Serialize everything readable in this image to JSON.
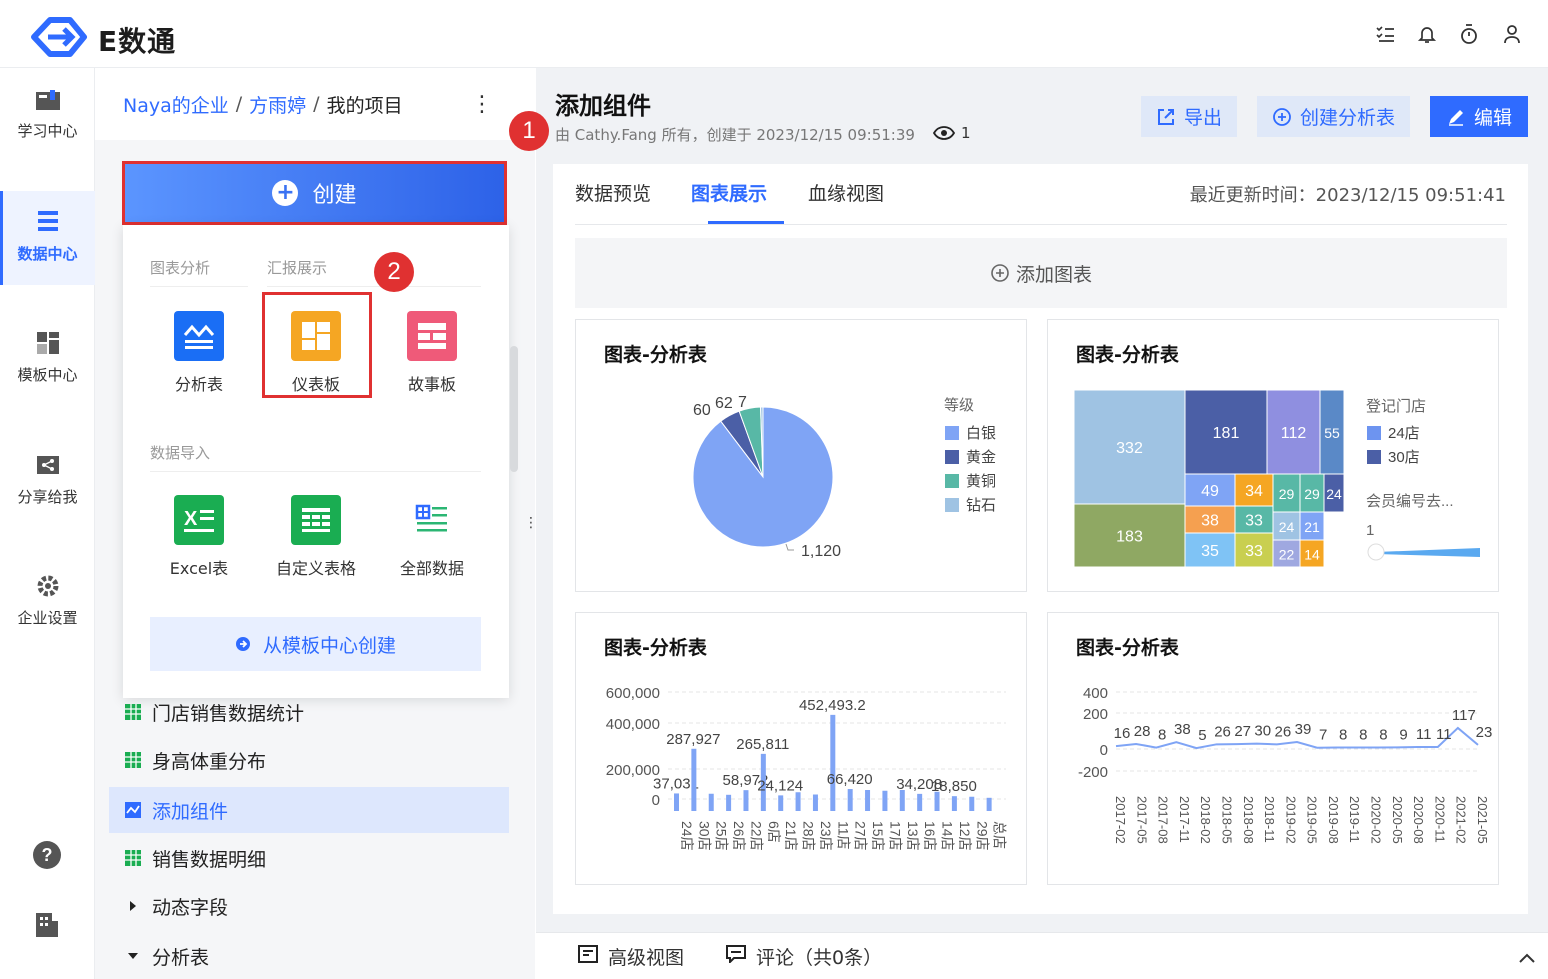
{
  "app": {
    "brand": "E数通",
    "brand_color": "#2f6bff"
  },
  "topbar": {
    "icons": [
      "checklist-icon",
      "bell-icon",
      "timer-icon",
      "user-icon"
    ]
  },
  "sidenav": {
    "items": [
      {
        "label": "学习中心",
        "icon": "book-icon"
      },
      {
        "label": "数据中心",
        "icon": "database-icon",
        "active": true
      },
      {
        "label": "模板中心",
        "icon": "template-icon"
      },
      {
        "label": "分享给我",
        "icon": "share-icon"
      },
      {
        "label": "企业设置",
        "icon": "settings-icon"
      }
    ],
    "bottom_icons": [
      "help-icon",
      "building-icon"
    ]
  },
  "breadcrumb": {
    "items": [
      "Naya的企业",
      "方雨婷",
      "我的项目"
    ],
    "separator": "/",
    "more": "⋮"
  },
  "create_button": {
    "label": "创建",
    "plus": "+"
  },
  "dropdown": {
    "section1": "图表分析",
    "section2": "汇报展示",
    "analysis_items": [
      {
        "label": "分析表",
        "color": "#1a6ef5"
      },
      {
        "label": "仪表板",
        "color": "#f5a623"
      },
      {
        "label": "故事板",
        "color": "#ef5a79"
      }
    ],
    "section3": "数据导入",
    "import_items": [
      {
        "label": "Excel表",
        "color": "#1aad52"
      },
      {
        "label": "自定义表格",
        "color": "#1aad52"
      },
      {
        "label": "全部数据",
        "color": "#2bb673"
      }
    ],
    "template_button": "从模板中心创建"
  },
  "tree": [
    {
      "label": "门店销售数据统计",
      "icon": "table-icon"
    },
    {
      "label": "身高体重分布",
      "icon": "table-icon"
    },
    {
      "label": "添加组件",
      "icon": "chart-icon",
      "selected": true
    },
    {
      "label": "销售数据明细",
      "icon": "table-icon"
    },
    {
      "label": "动态字段",
      "icon": "caret-right-icon"
    },
    {
      "label": "分析表",
      "icon": "caret-down-icon"
    }
  ],
  "markers": [
    "1",
    "2"
  ],
  "main": {
    "title": "添加组件",
    "meta": "由 Cathy.Fang 所有，创建于 2023/12/15 09:51:39",
    "views": "1",
    "buttons": {
      "export": "导出",
      "create_analysis": "创建分析表",
      "edit": "编辑"
    },
    "tabs": [
      "数据预览",
      "图表展示",
      "血缘视图"
    ],
    "active_tab": 1,
    "updated": "最近更新时间：2023/12/15 09:51:41",
    "add_chart": "添加图表"
  },
  "cards": {
    "pie_title": "图表-分析表",
    "treemap_title": "图表-分析表",
    "bar_title": "图表-分析表",
    "line_title": "图表-分析表"
  },
  "chart_data": [
    {
      "type": "pie",
      "title": "图表-分析表",
      "legend_title": "等级",
      "legend_position": "right",
      "slices": [
        {
          "name": "白银",
          "value": 1120,
          "label": "1,120",
          "color": "#7fa4f5"
        },
        {
          "name": "黄金",
          "value": 60,
          "label": "60",
          "color": "#4b5fa6"
        },
        {
          "name": "黄铜",
          "value": 62,
          "label": "62",
          "color": "#58b8a6"
        },
        {
          "name": "钻石",
          "value": 7,
          "label": "7",
          "color": "#9fc3e3"
        }
      ]
    },
    {
      "type": "treemap",
      "title": "图表-分析表",
      "legend_title": "登记门店",
      "legend_items": [
        {
          "name": "24店",
          "color": "#6d94f0"
        },
        {
          "name": "30店",
          "color": "#4b5fa6"
        }
      ],
      "slider": {
        "label": "会员编号去...",
        "value": "1"
      },
      "cells": [
        332,
        183,
        181,
        112,
        55,
        49,
        34,
        29,
        29,
        24,
        38,
        33,
        24,
        21,
        35,
        33,
        22,
        14
      ],
      "cell_colors": [
        "#9fc3e3",
        "#8fa863",
        "#4b5fa6",
        "#8f8fe0",
        "#5a89c7",
        "#7fa4f5",
        "#f5a623",
        "#58b8a6",
        "#58b8a6",
        "#4b5fa6",
        "#f5a050",
        "#58b8a6",
        "#9fc3e3",
        "#7fa4f5",
        "#7fc3f5",
        "#c9cf50",
        "#9fa8e0",
        "#f5a623"
      ]
    },
    {
      "type": "bar",
      "title": "图表-分析表",
      "ylim": [
        0,
        600000
      ],
      "yticks": [
        "600,000",
        "400,000",
        "200,000",
        "0"
      ],
      "categories": [
        "24店",
        "30店",
        "25店",
        "26店",
        "22店",
        "6店",
        "21店",
        "28店",
        "23店",
        "11店",
        "27店",
        "15店",
        "17店",
        "13店",
        "16店",
        "14店",
        "12店",
        "29店",
        "总店"
      ],
      "values": [
        37031,
        287927,
        35000,
        28000,
        58972,
        265811,
        24124,
        45000,
        30000,
        452493.2,
        66420,
        60000,
        55000,
        60000,
        34208,
        48000,
        18850,
        15000,
        8000
      ],
      "labels": {
        "0": "37,031",
        "1": "287,927",
        "4": "58,972",
        "5": "265,811",
        "6": "24,124",
        "9": "452,493.2",
        "10": "66,420",
        "14": "34,208",
        "16": "18,850"
      },
      "color": "#7fa4f5"
    },
    {
      "type": "line",
      "title": "图表-分析表",
      "ylim": [
        -200,
        400
      ],
      "yticks": [
        "400",
        "200",
        "0",
        "-200"
      ],
      "xticks": [
        "2017-02",
        "2017-05",
        "2017-08",
        "2017-11",
        "2018-02",
        "2018-05",
        "2018-08",
        "2018-11",
        "2019-02",
        "2019-05",
        "2019-08",
        "2019-11",
        "2020-02",
        "2020-05",
        "2020-08",
        "2020-11",
        "2021-02",
        "2021-05"
      ],
      "values": [
        16,
        28,
        8,
        38,
        5,
        26,
        27,
        30,
        26,
        39,
        7,
        8,
        8,
        8,
        9,
        11,
        11,
        117,
        23
      ],
      "labels": [
        "16",
        "28",
        "8",
        "38",
        "5",
        "26",
        "27",
        "30",
        "26",
        "39",
        "7",
        "8",
        "8",
        "8",
        "9",
        "11",
        "11",
        "117",
        "23"
      ],
      "color": "#7fa4f5"
    }
  ],
  "bottombar": {
    "advanced_view": "高级视图",
    "comments": "评论（共0条）"
  }
}
